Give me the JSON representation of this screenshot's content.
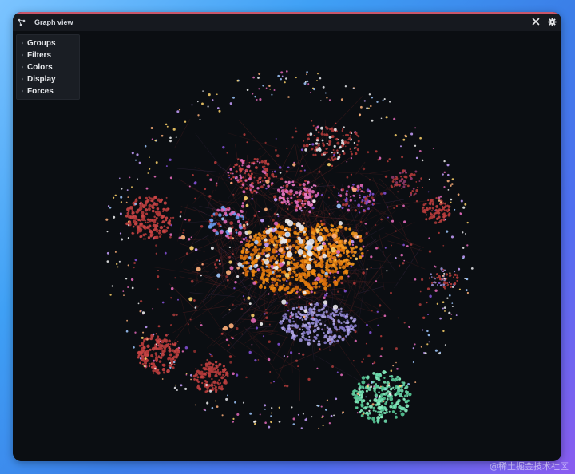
{
  "window": {
    "title": "Graph view"
  },
  "toolbar": {
    "close_icon": "close-icon",
    "settings_icon": "gear-icon",
    "graph_icon": "graph-view-icon"
  },
  "menu": {
    "items": [
      {
        "label": "Groups"
      },
      {
        "label": "Filters"
      },
      {
        "label": "Colors"
      },
      {
        "label": "Display"
      },
      {
        "label": "Forces"
      }
    ]
  },
  "graph": {
    "background": "#0b0e12",
    "clusters": [
      {
        "name": "orange",
        "color": "#e07a10"
      },
      {
        "name": "red",
        "color": "#b23a3a"
      },
      {
        "name": "lavender",
        "color": "#9a8fd6"
      },
      {
        "name": "mint",
        "color": "#6fdcae"
      },
      {
        "name": "pink",
        "color": "#e069b8"
      },
      {
        "name": "white",
        "color": "#e9e9ee"
      }
    ]
  },
  "watermark": "@稀土掘金技术社区"
}
